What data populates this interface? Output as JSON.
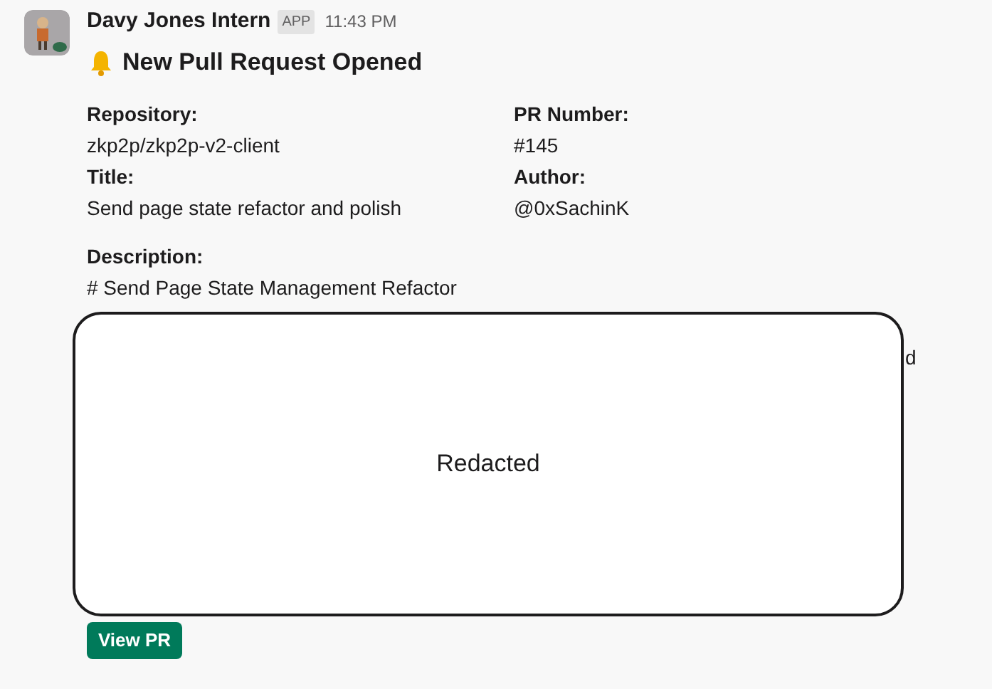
{
  "message": {
    "sender": "Davy Jones Intern",
    "badge": "APP",
    "time": "11:43 PM",
    "title": "New Pull Request Opened"
  },
  "fields": [
    {
      "label": "Repository:",
      "value": "zkp2p/zkp2p-v2-client"
    },
    {
      "label": "PR Number:",
      "value": "#145"
    },
    {
      "label": "Title:",
      "value": "Send page state refactor and polish"
    },
    {
      "label": "Author:",
      "value": "@0xSachinK"
    }
  ],
  "description": {
    "label": "Description:",
    "value": "# Send Page State Management Refactor",
    "overflow_fragment": "d"
  },
  "redaction": {
    "label": "Redacted"
  },
  "button": {
    "label": "View PR"
  }
}
